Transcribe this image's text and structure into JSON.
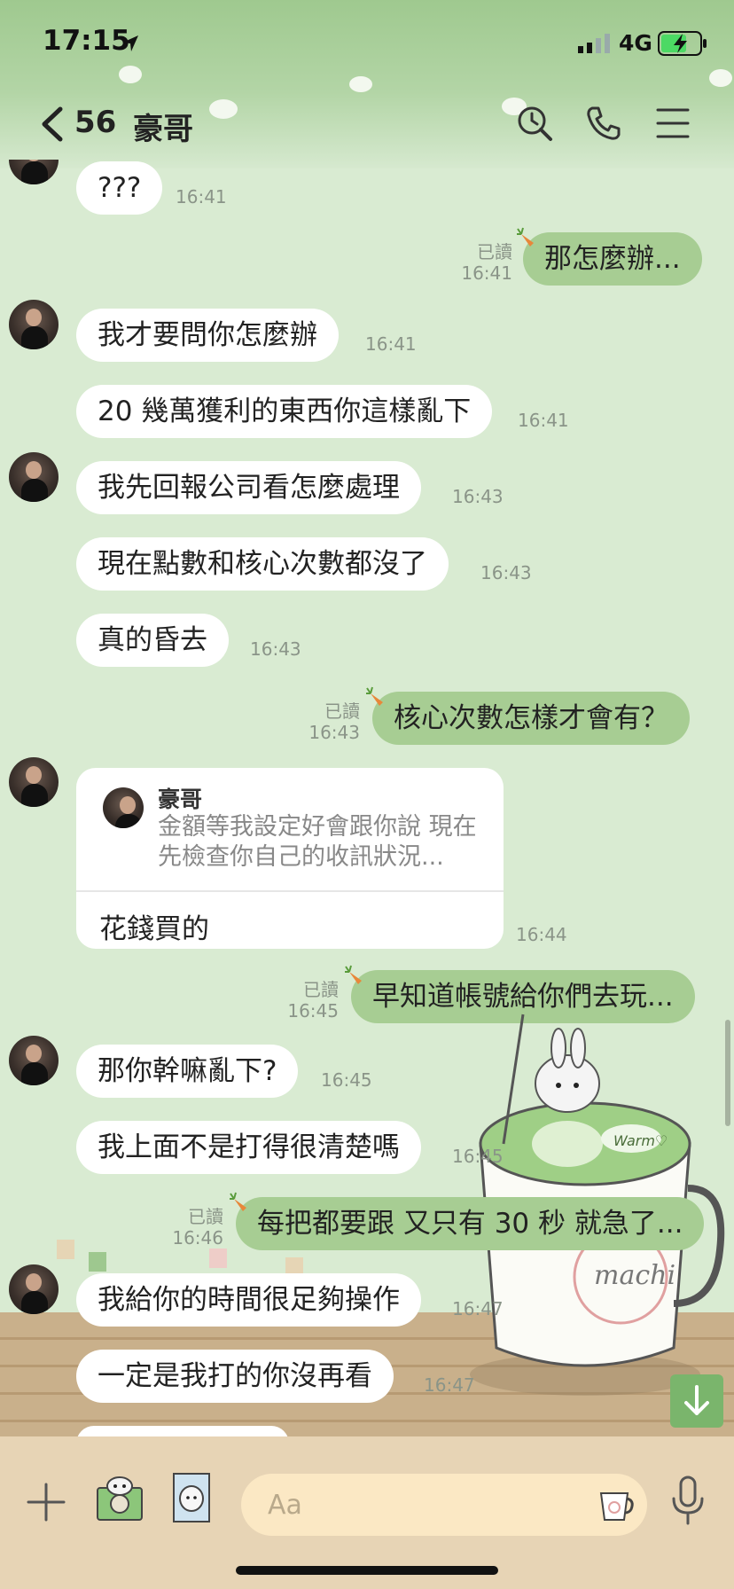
{
  "status": {
    "time": "17:15",
    "network": "4G"
  },
  "nav": {
    "unread_count": "56",
    "contact_name": "豪哥"
  },
  "messages": [
    {
      "dir": "in",
      "text": "???",
      "time": "16:41"
    },
    {
      "dir": "out",
      "text": "那怎麼辦...",
      "read": "已讀",
      "time": "16:41"
    },
    {
      "dir": "in",
      "text": "我才要問你怎麼辦",
      "time": "16:41"
    },
    {
      "dir": "in",
      "text": "20 幾萬獲利的東西你這樣亂下",
      "time": "16:41"
    },
    {
      "dir": "in",
      "text": "我先回報公司看怎麼處理",
      "time": "16:43"
    },
    {
      "dir": "in",
      "text": "現在點數和核心次數都沒了",
      "time": "16:43"
    },
    {
      "dir": "in",
      "text": "真的昏去",
      "time": "16:43"
    },
    {
      "dir": "out",
      "text": "核心次數怎樣才會有？",
      "read": "已讀",
      "time": "16:43"
    },
    {
      "dir": "in",
      "reply_name": "豪哥",
      "reply_quote": "金額等我設定好會跟你說 現在先檢查你自己的收訊狀況...",
      "text": "花錢買的",
      "time": "16:44"
    },
    {
      "dir": "out",
      "text": "早知道帳號給你們去玩...",
      "read": "已讀",
      "time": "16:45"
    },
    {
      "dir": "in",
      "text": "那你幹嘛亂下?",
      "time": "16:45"
    },
    {
      "dir": "in",
      "text": "我上面不是打得很清楚嗎",
      "time": "16:45"
    },
    {
      "dir": "out",
      "text": "每把都要跟 又只有 30 秒 就急了...",
      "read": "已讀",
      "time": "16:46"
    },
    {
      "dir": "in",
      "text": "我給你的時間很足夠操作",
      "time": "16:47"
    },
    {
      "dir": "in",
      "text": "一定是我打的你沒再看",
      "time": "16:47"
    }
  ],
  "input": {
    "placeholder": "Aa"
  },
  "deco": {
    "mug_text": "machi",
    "warm_text": "Warm♡"
  },
  "colors": {
    "bubble_out": "#a7cd93",
    "bubble_in": "#ffffff",
    "bg": "#d9ebd2"
  }
}
